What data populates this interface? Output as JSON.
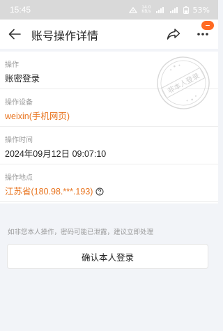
{
  "status_bar": {
    "time": "15:45",
    "battery": "53%",
    "speed_top": "14.0",
    "speed_bottom": "KB/s"
  },
  "header": {
    "title": "账号操作详情",
    "back_icon": "back-arrow-icon",
    "share_icon": "share-icon",
    "more_icon": "more-icon"
  },
  "stamp_text": "非本人登录",
  "details": {
    "operation": {
      "label": "操作",
      "value": "账密登录"
    },
    "device": {
      "label": "操作设备",
      "value": "weixin(手机网页)"
    },
    "time": {
      "label": "操作时间",
      "value": "2024年09月12日 09:07:10"
    },
    "location": {
      "label": "操作地点",
      "value": "江苏省(180.98.***.193)"
    }
  },
  "warning": "如非您本人操作，密码可能已泄露，建议立即处理",
  "confirm_button": "确认本人登录",
  "colors": {
    "accent": "#e8741f",
    "badge": "#ff6a22",
    "background": "#f2f4f8"
  }
}
